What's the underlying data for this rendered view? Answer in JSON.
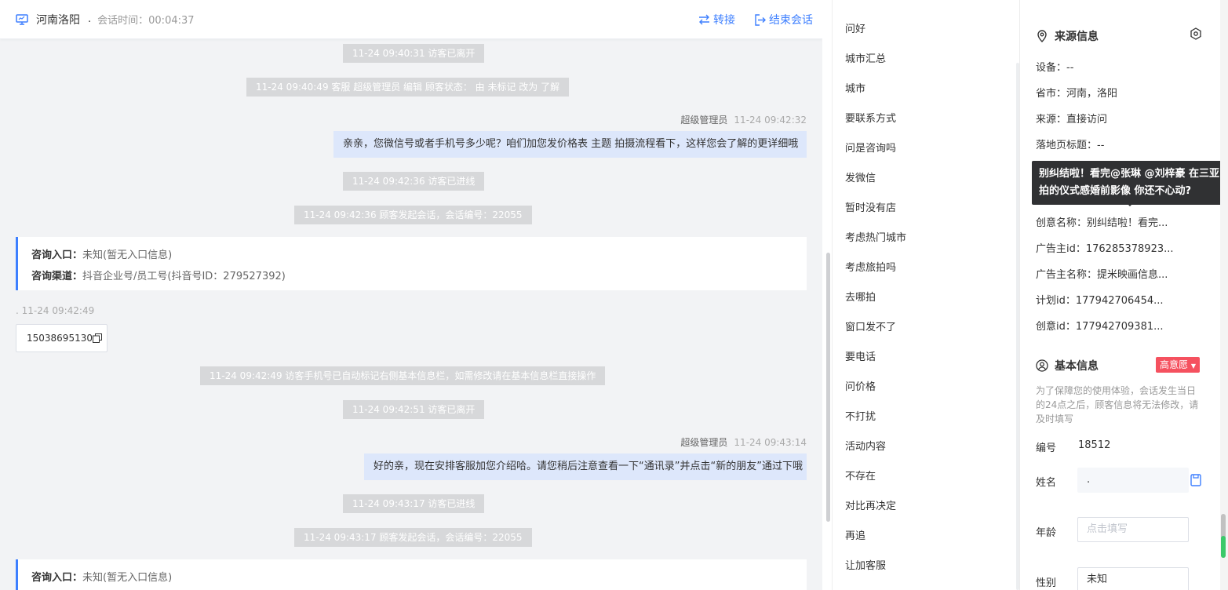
{
  "header": {
    "region": "河南洛阳",
    "dot": ".",
    "session_time": "会话时间：00:04:37",
    "transfer_label": "转接",
    "end_label": "结束会话"
  },
  "messages": {
    "sys1": "11-24 09:40:31 访客已离开",
    "sys2": "11-24 09:40:49 客服 超级管理员 编辑 顾客状态： 由 未标记 改为 了解",
    "agent1_name": "超级管理员",
    "agent1_time": "11-24 09:42:32",
    "agent1_text": "亲亲，您微信号或者手机号多少呢？咱们加您发价格表 主题 拍摄流程看下，这样您会了解的更详细哦",
    "sys3": "11-24 09:42:36 访客已进线",
    "sys4": "11-24 09:42:36 顾客发起会话，会话编号：22055",
    "entry1_k1": "咨询入口：",
    "entry1_v1": "未知(暂无入口信息)",
    "entry1_k2": "咨询渠道：",
    "entry1_v2": "抖音企业号/员工号(抖音号ID：279527392)",
    "visitor_meta": ".  11-24 09:42:49",
    "visitor_phone": "15038695130",
    "sys5": "11-24 09:42:49 访客手机号已自动标记右侧基本信息栏，如需修改请在基本信息栏直接操作",
    "sys6": "11-24 09:42:51 访客已离开",
    "agent2_name": "超级管理员",
    "agent2_time": "11-24 09:43:14",
    "agent2_text": "好的亲，现在安排客服加您介绍哈。请您稍后注意查看一下“通讯录”并点击“新的朋友”通过下哦",
    "sys7": "11-24 09:43:17 访客已进线",
    "sys8": "11-24 09:43:17 顾客发起会话，会话编号：22055",
    "entry2_k1": "咨询入口：",
    "entry2_v1": "未知(暂无入口信息)"
  },
  "phrases": [
    "问好",
    "城市汇总",
    "城市",
    "要联系方式",
    "问是咨询吗",
    "发微信",
    "暂时没有店",
    "考虑热门城市",
    "考虑旅拍吗",
    "去哪拍",
    "窗口发不了",
    "要电话",
    "问价格",
    "不打扰",
    "活动内容",
    "不存在",
    "对比再决定",
    "再追",
    "让加客服"
  ],
  "source": {
    "title": "来源信息",
    "device": "设备：--",
    "province": "省市：河南，洛阳",
    "from": "来源：直接访问",
    "landing": "落地页标题：--",
    "creative_name": "创意名称：别纠结啦！看完...",
    "advertiser_id": "广告主id：176285378923...",
    "advertiser_name": "广告主名称：提米映画信息...",
    "plan_id": "计划id：177942706454...",
    "creative_id": "创意id：177942709381..."
  },
  "tooltip": "别纠结啦！看完@张琳 @刘梓豪 在三亚拍的仪式感婚前影像 你还不心动?",
  "basic": {
    "title": "基本信息",
    "intent_badge": "高意愿",
    "notice": "为了保障您的使用体验，会话发生当日的24点之后，顾客信息将无法修改，请及时填写",
    "id_label": "编号",
    "id_value": "18512",
    "name_label": "姓名",
    "name_value": ".",
    "age_label": "年龄",
    "age_placeholder": "点击填写",
    "gender_label": "性别",
    "gender_value": "未知"
  },
  "colors": {
    "accent": "#3d7fff",
    "system_bubble": "#d7d8da",
    "agent_bubble": "#dde7fb",
    "badge_red": "#f5515f"
  }
}
